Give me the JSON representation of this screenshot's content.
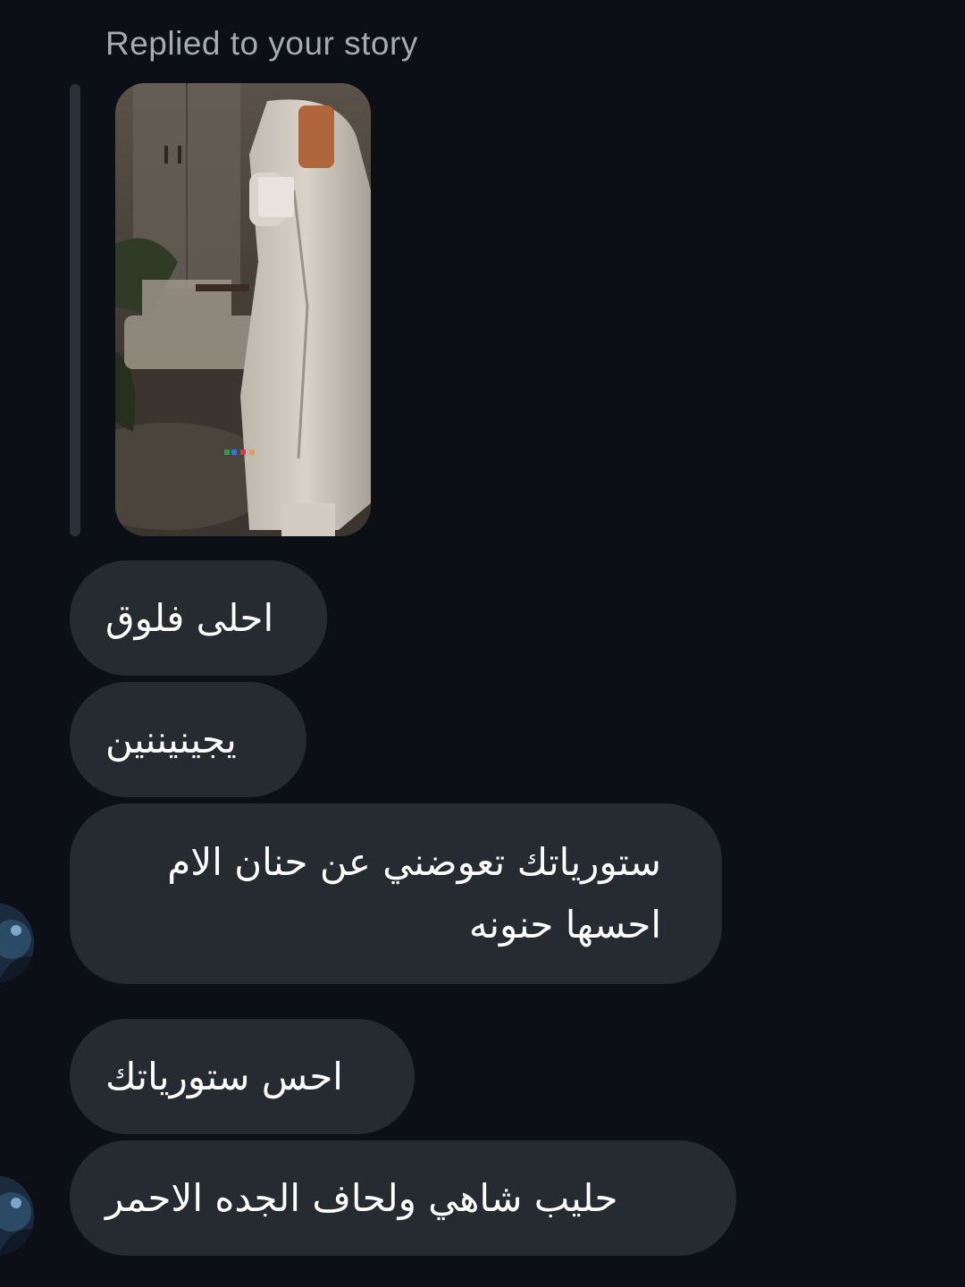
{
  "chat": {
    "reply_header": "Replied to your story",
    "story": {
      "image_description_icon": "story-thumbnail-image"
    },
    "messages": [
      {
        "text": "احلى فلوق"
      },
      {
        "text": "يجينيننين"
      },
      {
        "text": "ستورياتك تعوضني عن حنان الام احسها حنونه"
      },
      {
        "text": "احس ستورياتك"
      },
      {
        "text": "حليب شاهي ولحاف الجده الاحمر"
      }
    ]
  },
  "colors": {
    "background": "#0c1016",
    "bubble": "#262a31",
    "header_text": "#a6abb3",
    "message_text": "#ffffff"
  }
}
